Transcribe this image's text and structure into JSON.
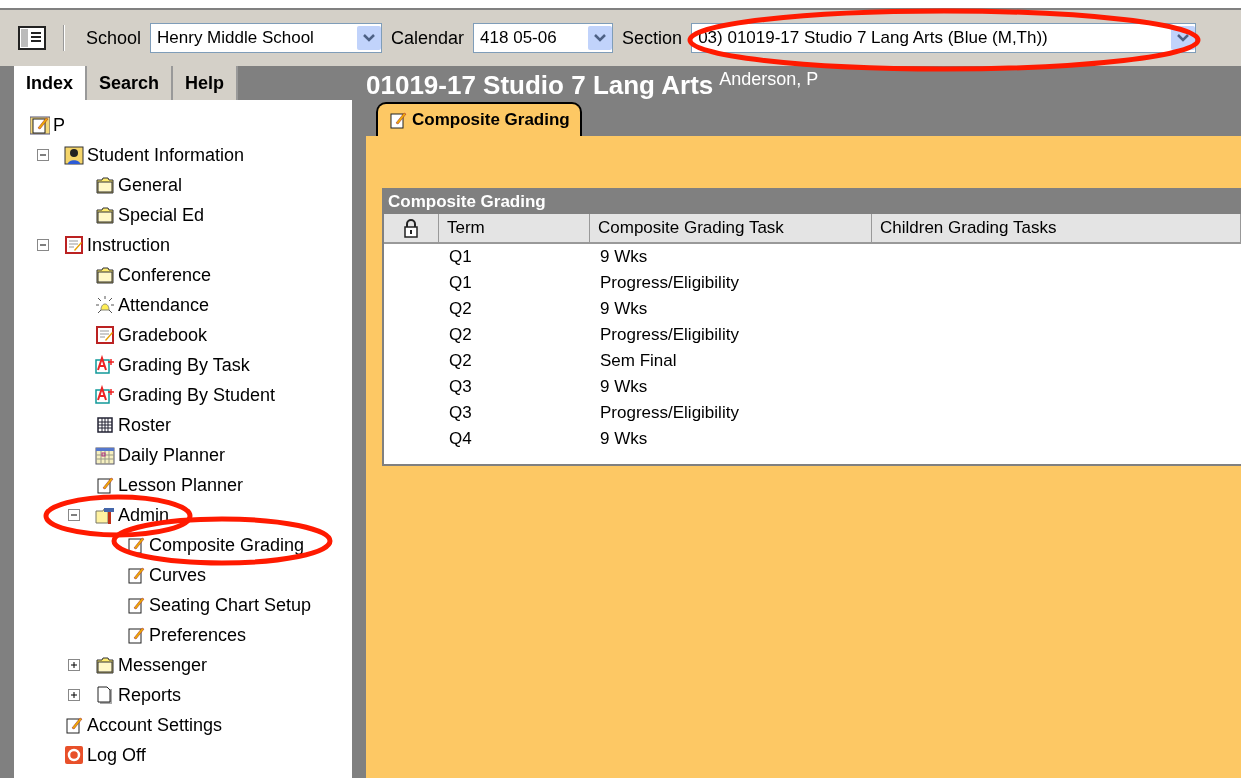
{
  "toolbar": {
    "fields": [
      {
        "label": "School",
        "value": "Henry Middle School"
      },
      {
        "label": "Calendar",
        "value": "418 05-06"
      },
      {
        "label": "Section",
        "value": "03) 01019-17 Studio 7 Lang Arts (Blue (M,Th))"
      }
    ]
  },
  "sidebar": {
    "tabs": [
      {
        "label": "Index",
        "selected": true
      },
      {
        "label": "Search",
        "selected": false
      },
      {
        "label": "Help",
        "selected": false
      }
    ],
    "tree": [
      {
        "label": "P",
        "kind": "notepad-gold",
        "children": [
          {
            "label": "Student Information",
            "kind": "student",
            "expanded": true,
            "children": [
              {
                "label": "General",
                "kind": "folder"
              },
              {
                "label": "Special Ed",
                "kind": "folder"
              }
            ]
          },
          {
            "label": "Instruction",
            "kind": "gradebook",
            "expanded": true,
            "children": [
              {
                "label": "Conference",
                "kind": "folder"
              },
              {
                "label": "Attendance",
                "kind": "bell"
              },
              {
                "label": "Gradebook",
                "kind": "gradebook"
              },
              {
                "label": "Grading By Task",
                "kind": "grade"
              },
              {
                "label": "Grading By Student",
                "kind": "grade"
              },
              {
                "label": "Roster",
                "kind": "roster"
              },
              {
                "label": "Daily Planner",
                "kind": "planner"
              },
              {
                "label": "Lesson Planner",
                "kind": "notepad"
              },
              {
                "label": "Admin",
                "kind": "tools",
                "expanded": true,
                "children": [
                  {
                    "label": "Composite Grading",
                    "kind": "notepad"
                  },
                  {
                    "label": "Curves",
                    "kind": "notepad"
                  },
                  {
                    "label": "Seating Chart Setup",
                    "kind": "notepad"
                  },
                  {
                    "label": "Preferences",
                    "kind": "notepad"
                  }
                ]
              },
              {
                "label": "Messenger",
                "kind": "folder",
                "expanded": false
              },
              {
                "label": "Reports",
                "kind": "page",
                "expanded": false
              }
            ]
          },
          {
            "label": "Account Settings",
            "kind": "notepad"
          },
          {
            "label": "Log Off",
            "kind": "power"
          }
        ]
      }
    ]
  },
  "main": {
    "title": "01019-17 Studio 7 Lang Arts",
    "teacher": "Anderson, P",
    "tabs": [
      {
        "label": "Composite Grading",
        "selected": true
      }
    ],
    "table": {
      "title": "Composite Grading",
      "columns": [
        "Term",
        "Composite Grading Task",
        "Children Grading Tasks"
      ],
      "rows": [
        [
          "Q1",
          "9 Wks"
        ],
        [
          "Q1",
          "Progress/Eligibility"
        ],
        [
          "Q2",
          "9 Wks"
        ],
        [
          "Q2",
          "Progress/Eligibility"
        ],
        [
          "Q2",
          "Sem Final"
        ],
        [
          "Q3",
          "9 Wks"
        ],
        [
          "Q3",
          "Progress/Eligibility"
        ],
        [
          "Q4",
          "9 Wks"
        ]
      ]
    }
  }
}
